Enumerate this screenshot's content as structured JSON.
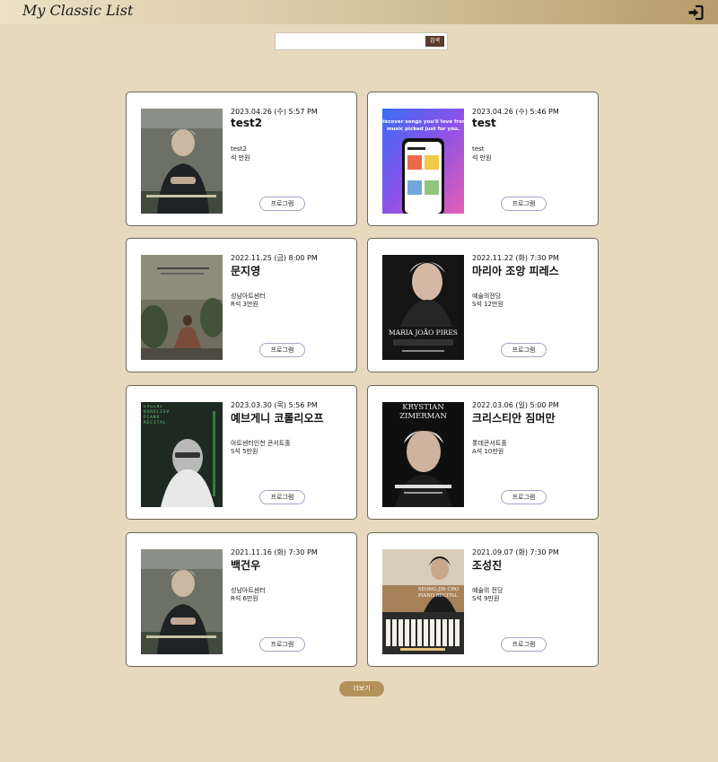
{
  "app": {
    "title": "My Classic List",
    "login_icon": "login-icon"
  },
  "search": {
    "value": "",
    "placeholder": "",
    "button_label": "검색"
  },
  "concerts": [
    {
      "date": "2023.04.26 (수) 5:57 PM",
      "title": "test2",
      "venue": "test2",
      "seat": "석 만원",
      "program_label": "프로그램",
      "poster": "poster-pianist-cover"
    },
    {
      "date": "2023.04.26 (수) 5:46 PM",
      "title": "test",
      "venue": "test",
      "seat": "석 만원",
      "program_label": "프로그램",
      "poster": "poster-music-app",
      "poster_text": "Discover songs you'll love from music picked just for you."
    },
    {
      "date": "2022.11.25 (금) 8:00 PM",
      "title": "문지영",
      "venue": "성남아트센터",
      "seat": "R석 3만원",
      "program_label": "프로그램",
      "poster": "poster-room-piano"
    },
    {
      "date": "2022.11.22 (화) 7:30 PM",
      "title": "마리아 조앙 피레스",
      "venue": "예술의전당",
      "seat": "S석 12만원",
      "program_label": "프로그램",
      "poster": "poster-portrait",
      "poster_text": "MARIA JOÃO PIRES"
    },
    {
      "date": "2023.03.30 (목) 5:56 PM",
      "title": "예브게니 코롤리오프",
      "venue": "아트센터인천 콘서트홀",
      "seat": "S석 5만원",
      "program_label": "프로그램",
      "poster": "poster-recital-green",
      "poster_text": "EVGENI KOROLIOV PIANO RECITAL"
    },
    {
      "date": "2022.03.06 (일) 5:00 PM",
      "title": "크리스티안 짐머만",
      "venue": "롯데콘서트홀",
      "seat": "A석 10만원",
      "program_label": "프로그램",
      "poster": "poster-dark-portrait",
      "poster_text": "KRYSTIAN ZIMERMAN"
    },
    {
      "date": "2021.11.16 (화) 7:30 PM",
      "title": "백건우",
      "venue": "성남아트센터",
      "seat": "R석 6만원",
      "program_label": "프로그램",
      "poster": "poster-pianist-cover"
    },
    {
      "date": "2021.09.07 (화) 7:30 PM",
      "title": "조성진",
      "venue": "예술의 전당",
      "seat": "S석 9만원",
      "program_label": "프로그램",
      "poster": "poster-piano-recital",
      "poster_text": "SEONG-JIN CHO PIANO RECITAL"
    }
  ],
  "more_label": "더보기"
}
